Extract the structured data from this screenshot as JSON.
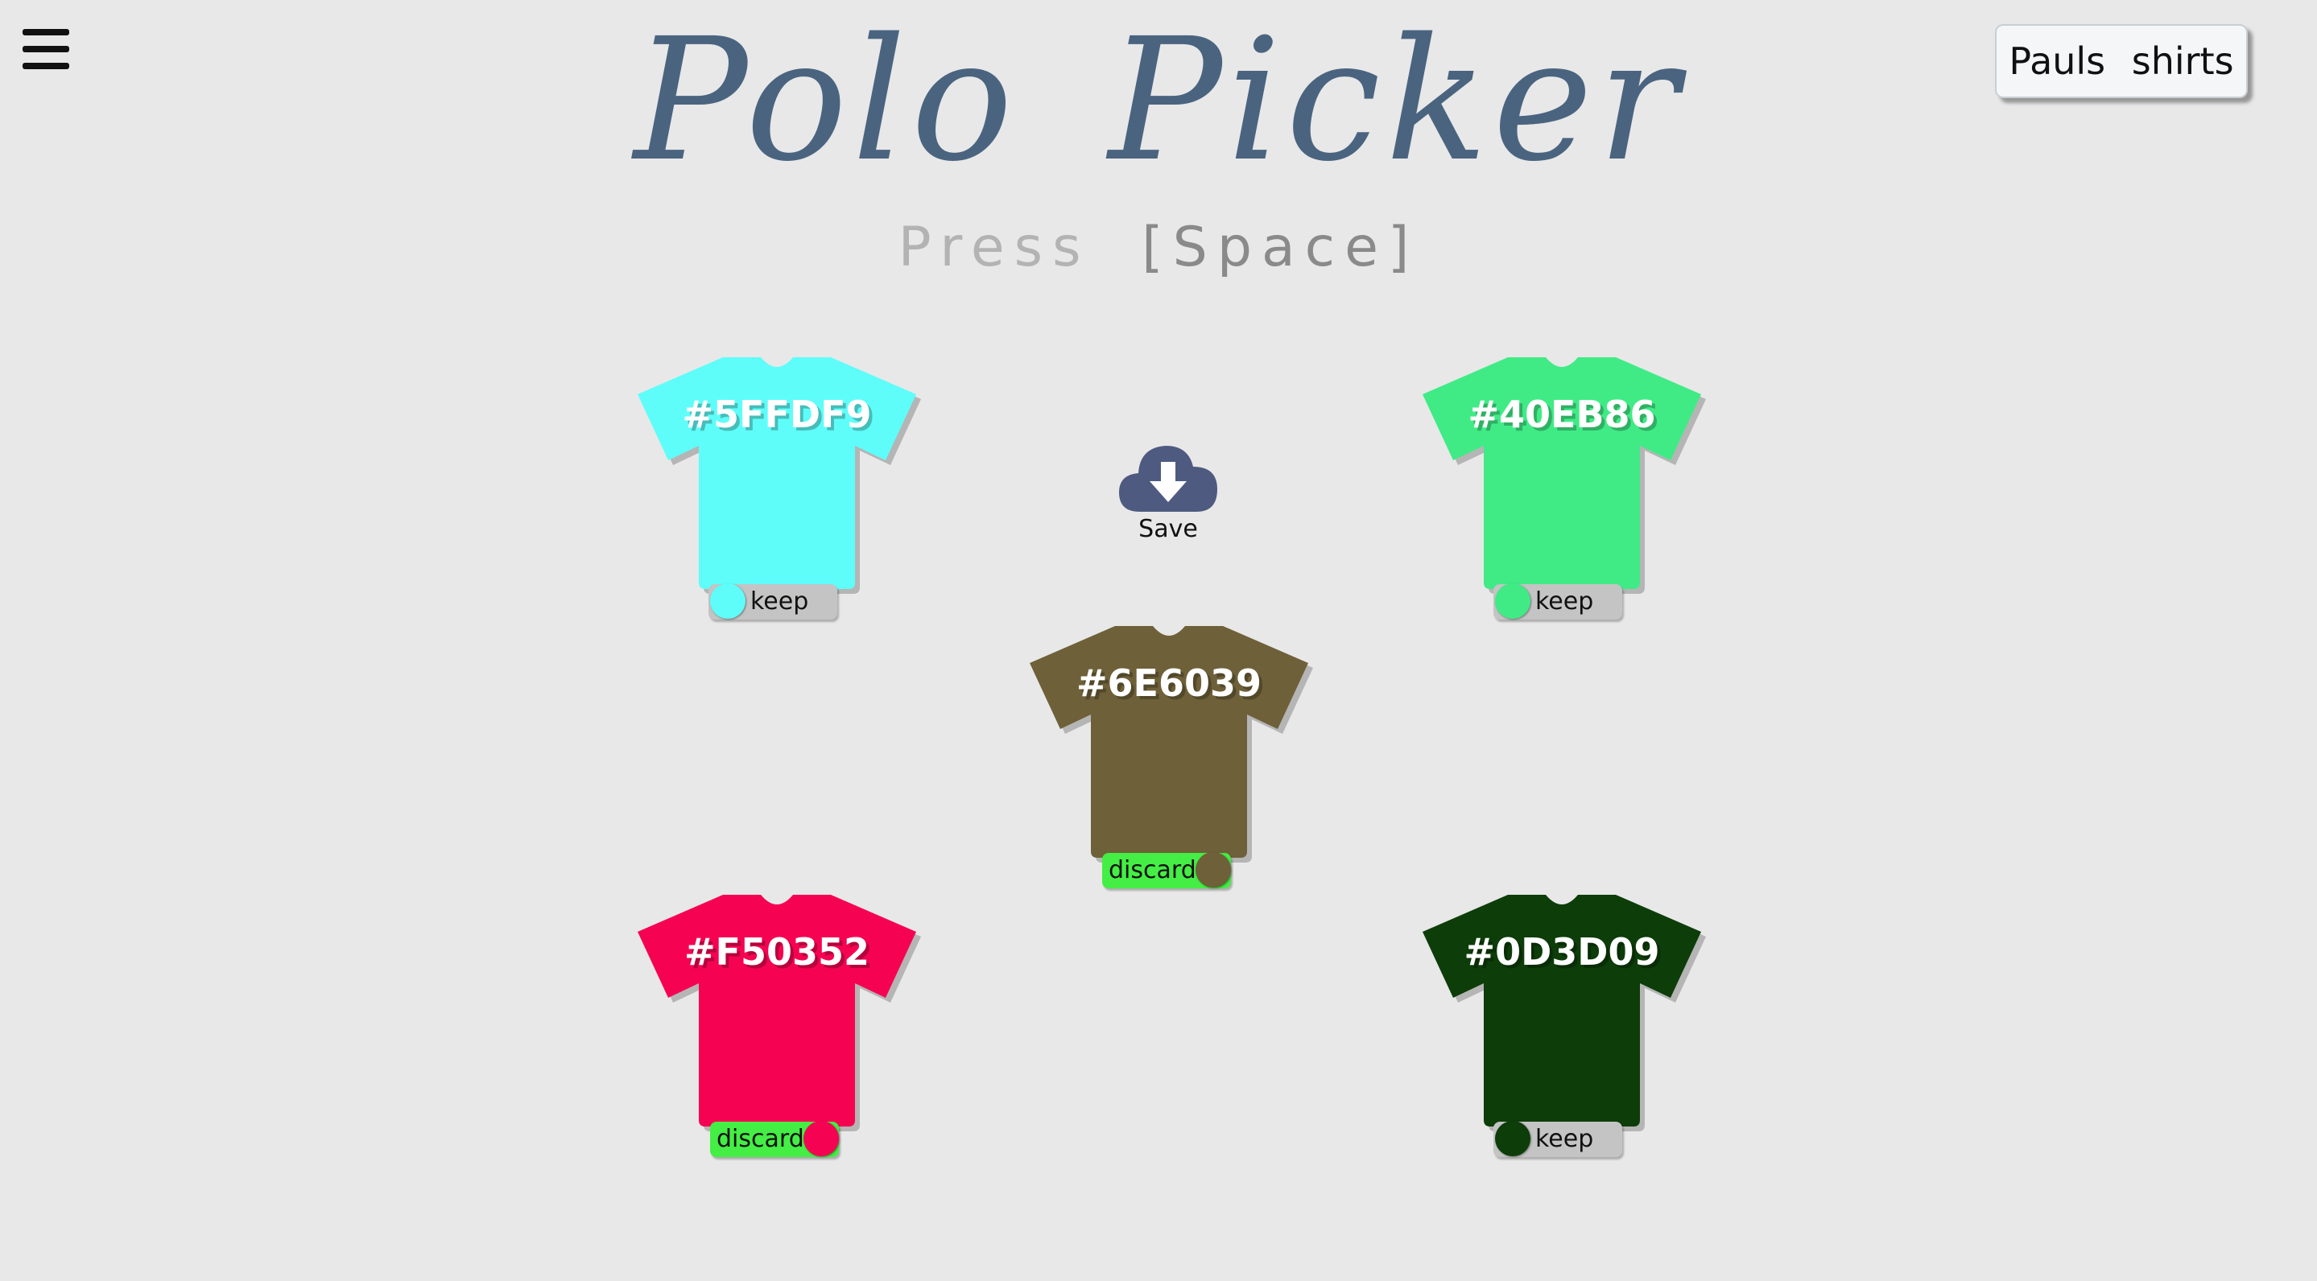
{
  "app": {
    "title": "Polo Picker",
    "hint_press": "Press",
    "hint_key": "[Space]",
    "user_badge": "Pauls shirts"
  },
  "colors": {
    "background": "#e8e8e8",
    "title": "#4a6480",
    "save_icon": "#4e5a80",
    "keep_toggle": "#c4c4c4",
    "discard_toggle": "#44ee44"
  },
  "icons": {
    "menu": "hamburger-icon",
    "save": "cloud-download-icon"
  },
  "save": {
    "label": "Save"
  },
  "shirts": [
    {
      "hex": "#5FFDF9",
      "color": "#5ffdf9",
      "status": "keep"
    },
    {
      "hex": "#40EB86",
      "color": "#40eb86",
      "status": "keep"
    },
    {
      "hex": "#6E6039",
      "color": "#6e6039",
      "status": "discard"
    },
    {
      "hex": "#F50352",
      "color": "#f50352",
      "status": "discard"
    },
    {
      "hex": "#0D3D09",
      "color": "#0d3d09",
      "status": "keep"
    }
  ]
}
